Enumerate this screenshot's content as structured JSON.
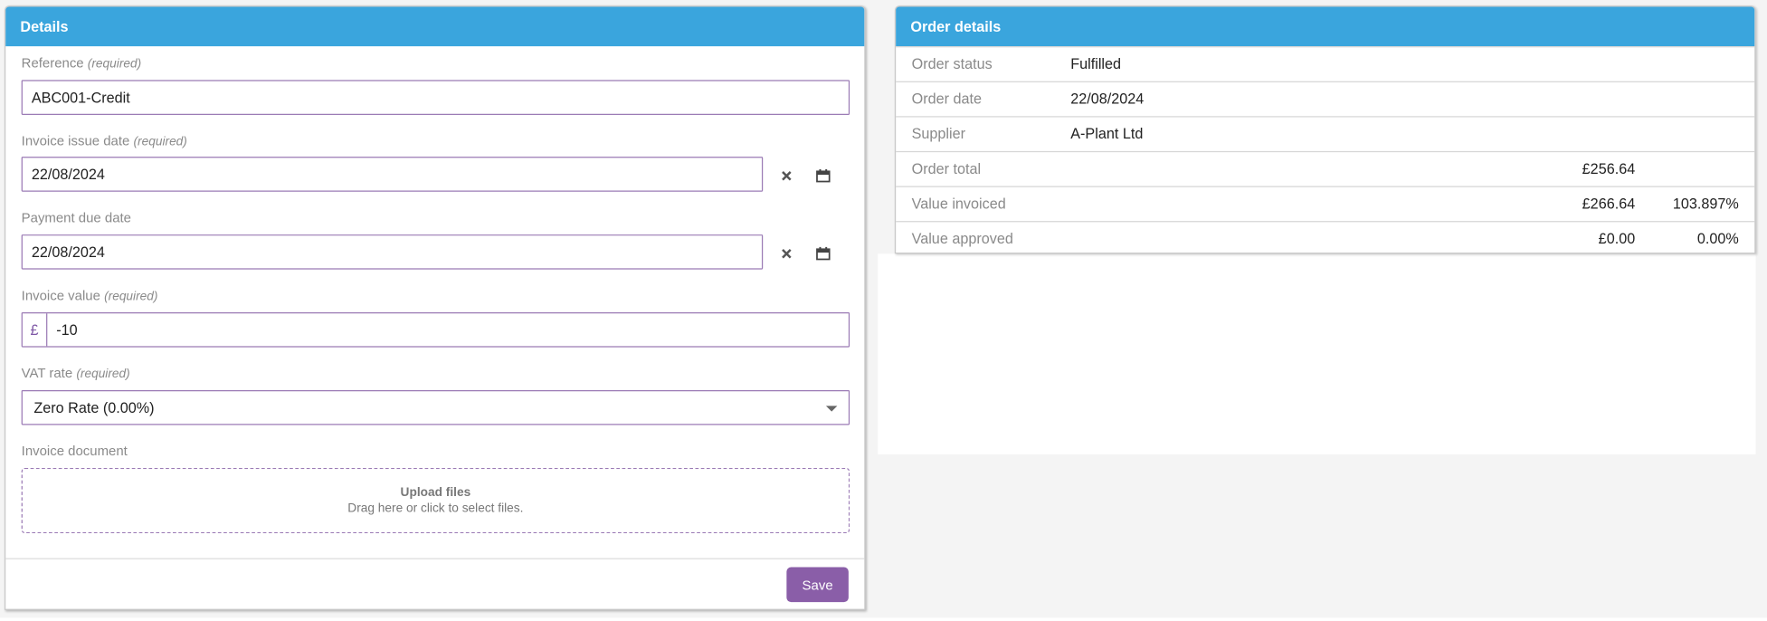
{
  "details": {
    "title": "Details",
    "reference": {
      "label": "Reference",
      "req": "(required)",
      "value": "ABC001-Credit"
    },
    "issue_date": {
      "label": "Invoice issue date",
      "req": "(required)",
      "value": "22/08/2024"
    },
    "due_date": {
      "label": "Payment due date",
      "value": "22/08/2024"
    },
    "invoice_value": {
      "label": "Invoice value",
      "req": "(required)",
      "currency": "£",
      "value": "-10"
    },
    "vat_rate": {
      "label": "VAT rate",
      "req": "(required)",
      "value": "Zero Rate (0.00%)"
    },
    "document": {
      "label": "Invoice document",
      "upload_title": "Upload files",
      "upload_hint": "Drag here or click to select files."
    },
    "save_label": "Save"
  },
  "order": {
    "title": "Order details",
    "rows": [
      {
        "label": "Order status",
        "value": "Fulfilled"
      },
      {
        "label": "Order date",
        "value": "22/08/2024"
      },
      {
        "label": "Supplier",
        "value": "A-Plant Ltd"
      },
      {
        "label": "Order total",
        "amount": "£256.64"
      },
      {
        "label": "Value invoiced",
        "amount": "£266.64",
        "percent": "103.897%"
      },
      {
        "label": "Value approved",
        "amount": "£0.00",
        "percent": "0.00%"
      }
    ]
  },
  "colors": {
    "header": "#3aa5dd",
    "accent": "#8a5ea8",
    "input_border": "#9b7bb5"
  }
}
